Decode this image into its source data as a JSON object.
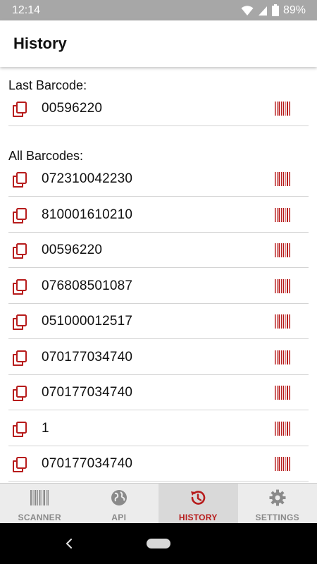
{
  "status": {
    "time": "12:14",
    "battery": "89%"
  },
  "header": {
    "title": "History"
  },
  "last_section": {
    "label": "Last Barcode:",
    "code": "00596220"
  },
  "all_section": {
    "label": "All Barcodes:",
    "items": [
      "072310042230",
      "810001610210",
      "00596220",
      "076808501087",
      "051000012517",
      "070177034740",
      "070177034740",
      "1",
      "070177034740"
    ]
  },
  "nav": {
    "items": [
      {
        "label": "SCANNER",
        "icon": "barcode-icon"
      },
      {
        "label": "API",
        "icon": "globe-icon"
      },
      {
        "label": "HISTORY",
        "icon": "history-icon"
      },
      {
        "label": "SETTINGS",
        "icon": "gear-icon"
      }
    ],
    "active": "HISTORY"
  },
  "colors": {
    "accent": "#b71c1c",
    "status_bar": "#a7a7a7",
    "nav_bg": "#ececec",
    "nav_active_bg": "#d9d9d9",
    "nav_inactive": "#8a8a8a"
  }
}
